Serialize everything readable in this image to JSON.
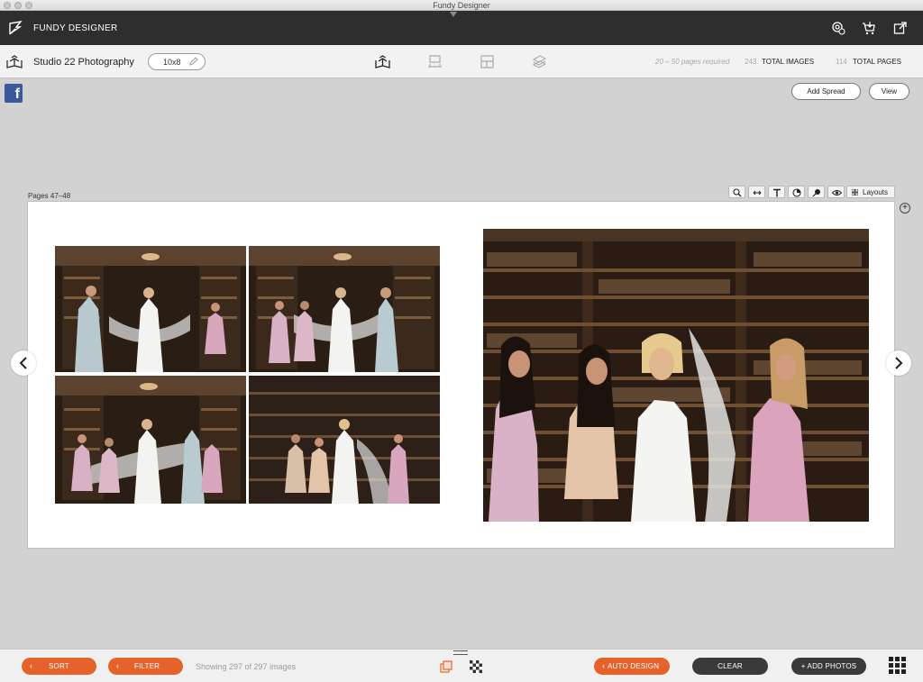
{
  "window": {
    "title": "Fundy Designer"
  },
  "app": {
    "name": "FUNDY DESIGNER"
  },
  "header_icons": [
    "settings-user-icon",
    "cart-icon",
    "export-icon"
  ],
  "project": {
    "studio_name": "Studio 22 Photography",
    "album_size": "10x8"
  },
  "modes": [
    "album-icon",
    "wall-display-icon",
    "card-icon",
    "image-box-icon"
  ],
  "stats": {
    "pages_required": "20 – 50 pages required",
    "total_images_count": "243",
    "total_images_label": "TOTAL IMAGES",
    "total_pages_count": "114",
    "total_pages_label": "TOTAL PAGES"
  },
  "canvas": {
    "add_spread_label": "Add Spread",
    "view_label": "View",
    "pages_label": "Pages 47–48",
    "layouts_label": "Layouts",
    "tools": [
      "zoom-icon",
      "swap-icon",
      "text-icon",
      "color-icon",
      "pin-icon",
      "eye-icon"
    ]
  },
  "footer": {
    "sort_label": "SORT",
    "filter_label": "FILTER",
    "showing_text": "Showing 297 of 297 images",
    "auto_design_label": "AUTO DESIGN",
    "clear_label": "CLEAR",
    "add_photos_label": "+ ADD PHOTOS"
  },
  "colors": {
    "accent_orange": "#e5632a",
    "dark_bar": "#2e2e2e",
    "facebook_blue": "#3b5998"
  }
}
